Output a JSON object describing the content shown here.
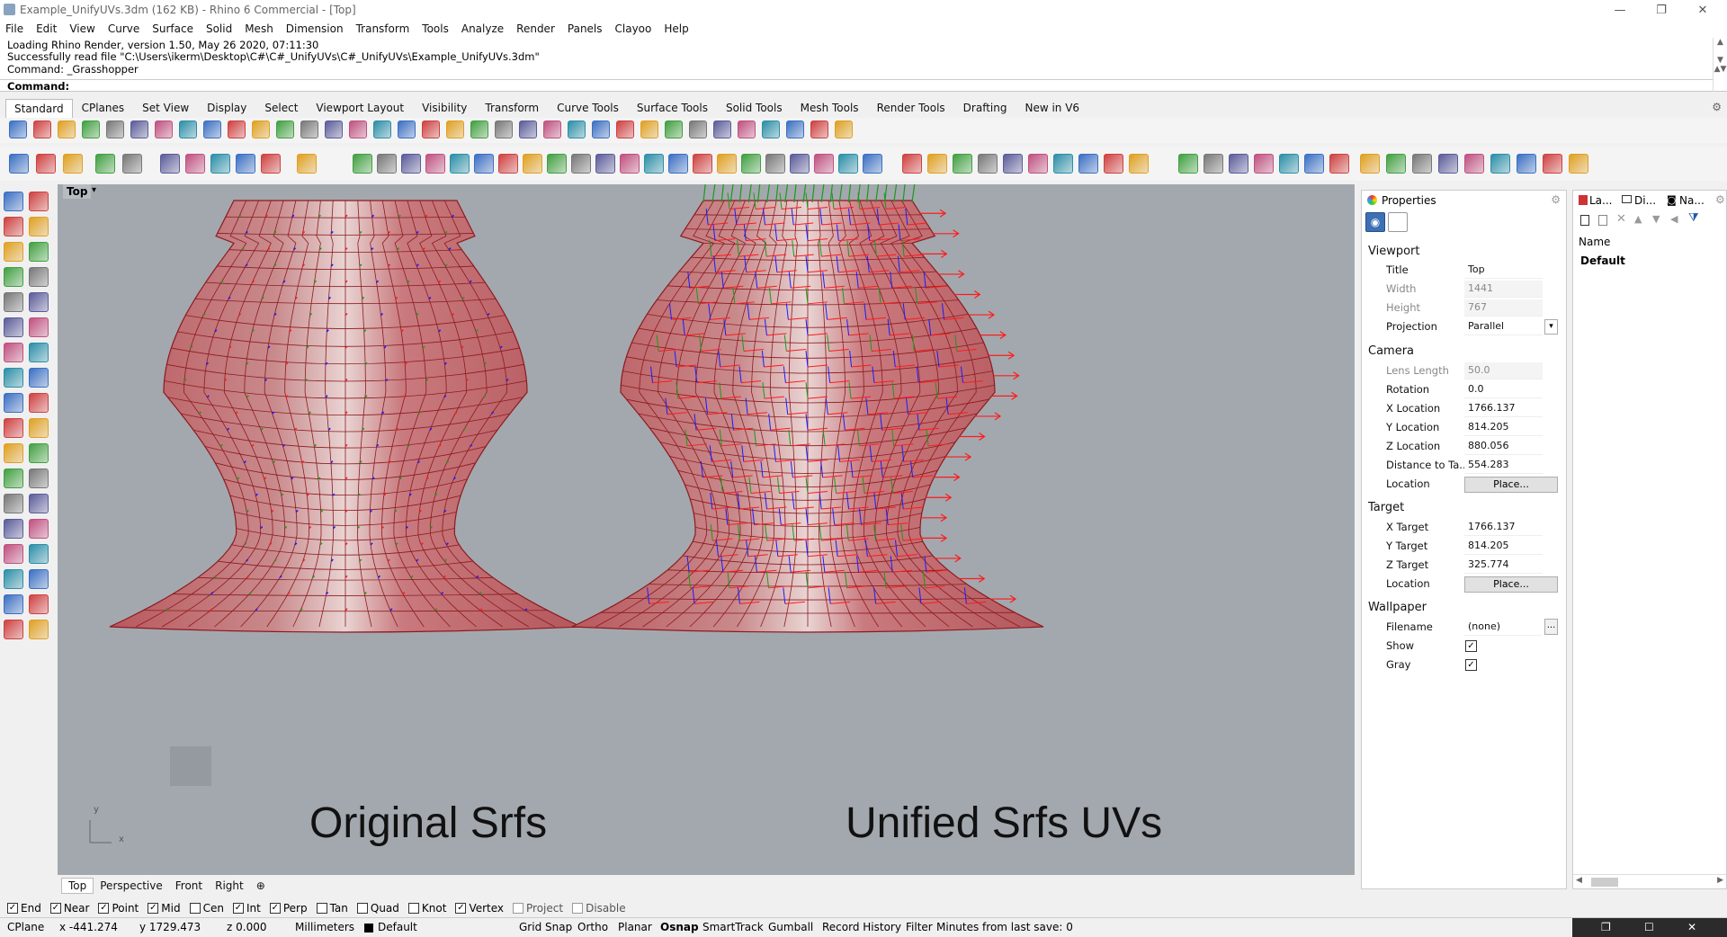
{
  "window": {
    "title": "Example_UnifyUVs.3dm (162 KB) - Rhino 6 Commercial - [Top]",
    "minimize": "—",
    "restore": "❐",
    "close": "✕"
  },
  "menu": [
    "File",
    "Edit",
    "View",
    "Curve",
    "Surface",
    "Solid",
    "Mesh",
    "Dimension",
    "Transform",
    "Tools",
    "Analyze",
    "Render",
    "Panels",
    "Clayoo",
    "Help"
  ],
  "command_history": [
    "Loading Rhino Render, version 1.50, May 26 2020, 07:11:30",
    "Successfully read file \"C:\\Users\\ikerm\\Desktop\\C#\\C#_UnifyUVs\\C#_UnifyUVs\\Example_UnifyUVs.3dm\"",
    "Command: _Grasshopper"
  ],
  "command_prompt": "Command:",
  "toolbar_tabs": [
    "Standard",
    "CPlanes",
    "Set View",
    "Display",
    "Select",
    "Viewport Layout",
    "Visibility",
    "Transform",
    "Curve Tools",
    "Surface Tools",
    "Solid Tools",
    "Mesh Tools",
    "Render Tools",
    "Drafting",
    "New in V6"
  ],
  "active_toolbar_tab": "Standard",
  "viewport": {
    "name": "Top",
    "label_left": "Original Srfs",
    "label_right": "Unified Srfs UVs",
    "axis_y": "y",
    "axis_x": "x"
  },
  "view_tabs": [
    "Top",
    "Perspective",
    "Front",
    "Right"
  ],
  "active_view_tab": "Top",
  "osnaps": [
    {
      "label": "End",
      "checked": true
    },
    {
      "label": "Near",
      "checked": true
    },
    {
      "label": "Point",
      "checked": true
    },
    {
      "label": "Mid",
      "checked": true
    },
    {
      "label": "Cen",
      "checked": false
    },
    {
      "label": "Int",
      "checked": true
    },
    {
      "label": "Perp",
      "checked": true
    },
    {
      "label": "Tan",
      "checked": false
    },
    {
      "label": "Quad",
      "checked": false
    },
    {
      "label": "Knot",
      "checked": false
    },
    {
      "label": "Vertex",
      "checked": true
    },
    {
      "label": "Project",
      "checked": false
    },
    {
      "label": "Disable",
      "checked": false
    }
  ],
  "status": {
    "cplane": "CPlane",
    "x": "x -441.274",
    "y": "y 1729.473",
    "z": "z 0.000",
    "units": "Millimeters",
    "layer": "Default",
    "grid_snap": "Grid Snap",
    "ortho": "Ortho",
    "planar": "Planar",
    "osnap": "Osnap",
    "smarttrack": "SmartTrack",
    "gumball": "Gumball",
    "record_history": "Record History",
    "filter": "Filter",
    "save_msg": "Minutes from last save: 0"
  },
  "properties": {
    "title": "Properties",
    "viewport_section": "Viewport",
    "camera_section": "Camera",
    "target_section": "Target",
    "wallpaper_section": "Wallpaper",
    "rows": {
      "title_label": "Title",
      "title_val": "Top",
      "width_label": "Width",
      "width_val": "1441",
      "height_label": "Height",
      "height_val": "767",
      "projection_label": "Projection",
      "projection_val": "Parallel",
      "lens_label": "Lens Length",
      "lens_val": "50.0",
      "rotation_label": "Rotation",
      "rotation_val": "0.0",
      "xloc_label": "X Location",
      "xloc_val": "1766.137",
      "yloc_label": "Y Location",
      "yloc_val": "814.205",
      "zloc_label": "Z Location",
      "zloc_val": "880.056",
      "dist_label": "Distance to Ta...",
      "dist_val": "554.283",
      "location_label": "Location",
      "place_btn": "Place...",
      "xt_label": "X Target",
      "xt_val": "1766.137",
      "yt_label": "Y Target",
      "yt_val": "814.205",
      "zt_label": "Z Target",
      "zt_val": "325.774",
      "tloc_label": "Location",
      "tplace_btn": "Place...",
      "file_label": "Filename",
      "file_val": "(none)",
      "file_btn": "...",
      "show_label": "Show",
      "gray_label": "Gray"
    }
  },
  "layers_panel": {
    "tabs": [
      "La...",
      "Di...",
      "Na..."
    ],
    "name_header": "Name",
    "layer_default": "Default"
  },
  "colors": {
    "viewport_bg": "#a3a8ae",
    "surface_fill": "#c06a6e",
    "grid_line": "#8c1a1f",
    "vec_red": "#ff1a1a",
    "vec_green": "#1a9a1a",
    "vec_blue": "#1a1aff"
  }
}
